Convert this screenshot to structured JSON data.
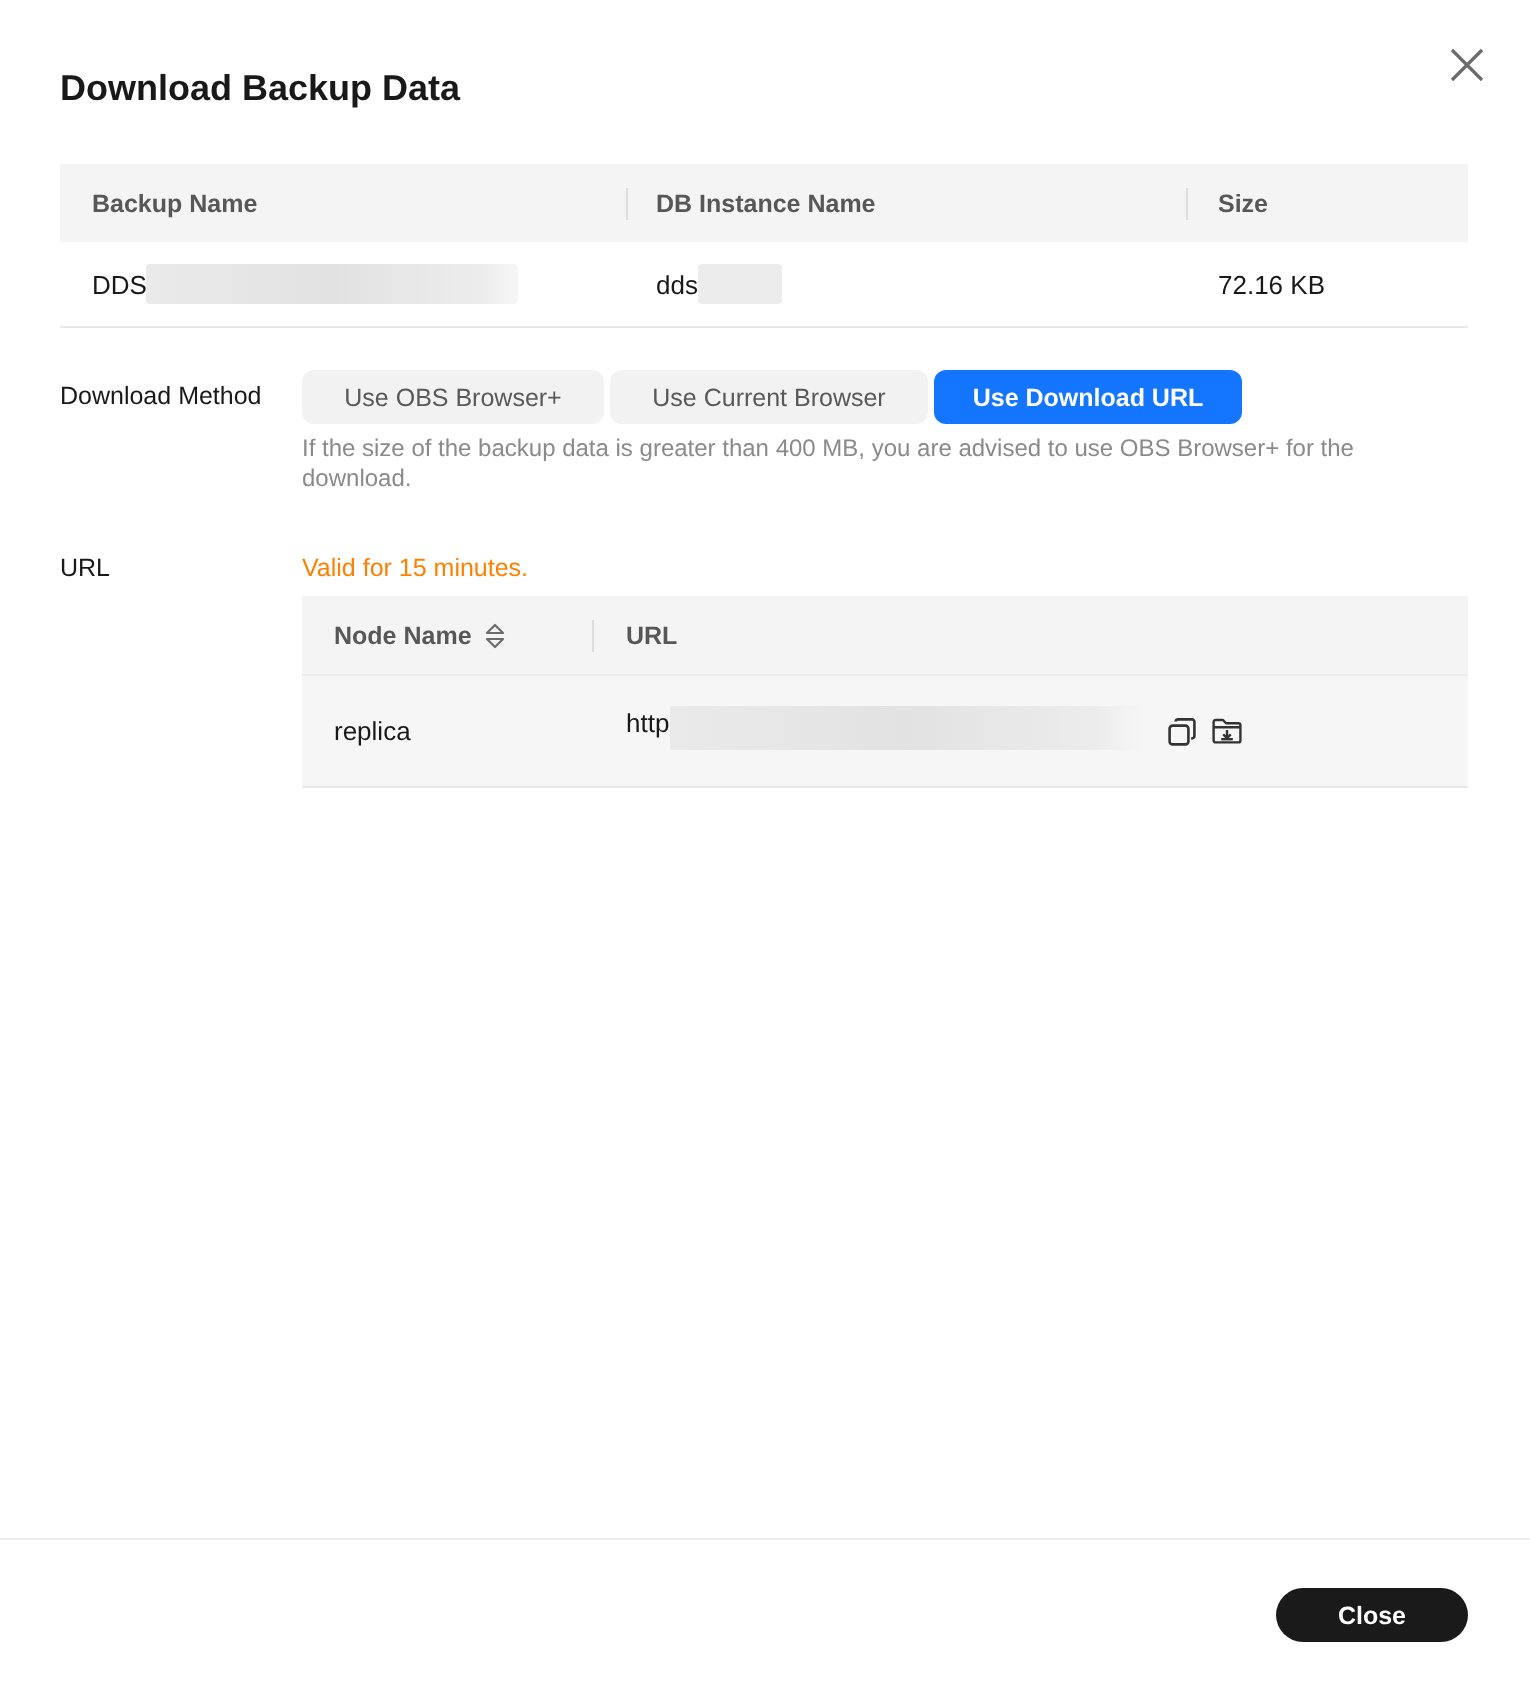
{
  "dialog": {
    "title": "Download Backup Data"
  },
  "backups_table": {
    "columns": [
      "Backup Name",
      "DB Instance Name",
      "Size"
    ],
    "rows": [
      {
        "cells": [
          {
            "text": "DDS",
            "blurred": true
          },
          {
            "text": "dds",
            "blurred": true
          },
          {
            "text": "72.16 KB",
            "blurred": false
          }
        ]
      }
    ]
  },
  "download_method": {
    "label": "Download Method",
    "options": [
      {
        "label": "Use OBS Browser+",
        "selected": false
      },
      {
        "label": "Use Current Browser",
        "selected": false
      },
      {
        "label": "Use Download URL",
        "selected": true
      }
    ],
    "hint": "If the size of the backup data is greater than 400 MB, you are advised to use OBS Browser+ for the download."
  },
  "url": {
    "label": "URL",
    "validity": "Valid for 15 minutes.",
    "table": {
      "columns": [
        {
          "label": "Node Name",
          "sortable": true
        },
        {
          "label": "URL",
          "sortable": false
        }
      ],
      "rows": [
        {
          "node_name": "replica",
          "url": {
            "text": "http",
            "blurred": true
          }
        }
      ]
    }
  },
  "footer": {
    "buttons": [
      "Close"
    ]
  }
}
